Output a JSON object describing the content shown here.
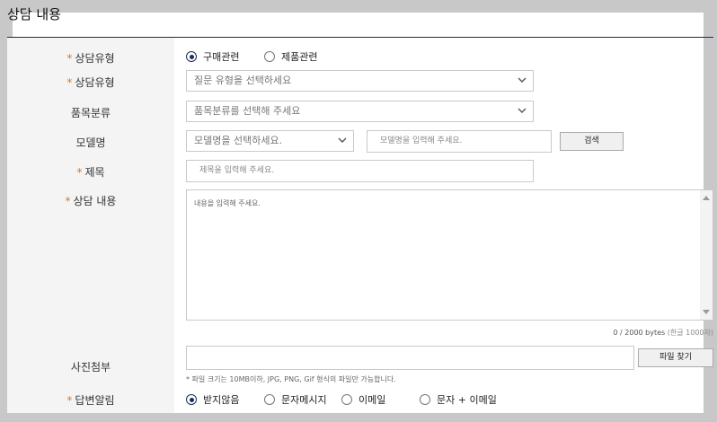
{
  "header": {
    "title": "상담 내용"
  },
  "form": {
    "inquiry_type": {
      "label": "상담유형",
      "required_mark": "*",
      "options": [
        "구매관련",
        "제품관련"
      ],
      "selected": 0
    },
    "inquiry_type_select": {
      "label": "상담유형",
      "required_mark": "*",
      "placeholder": "질문 유형을 선택하세요"
    },
    "category": {
      "label": "품목분류",
      "placeholder": "품목분류를 선택해 주세요"
    },
    "model": {
      "label": "모델명",
      "select_placeholder": "모델명을 선택하세요.",
      "input_placeholder": "모델명을 입력해 주세요.",
      "search_button": "검색"
    },
    "subject": {
      "label": "제목",
      "required_mark": "*",
      "placeholder": "제목을 입력해 주세요."
    },
    "content": {
      "label": "상담 내용",
      "required_mark": "*",
      "placeholder": "내용을 입력해 주세요.",
      "byte_count": "0 / 2000 bytes",
      "byte_hint": "(한글 1000자)"
    },
    "attachment": {
      "label": "사진첨부",
      "button": "파일 찾기",
      "note": "* 파일 크기는 10MB이하, JPG, PNG, Gif 형식의 파일만 가능합니다."
    },
    "reply_notify": {
      "label": "답변알림",
      "required_mark": "*",
      "options": [
        "받지않음",
        "문자메시지",
        "이메일",
        "문자 + 이메일"
      ],
      "selected": 0
    }
  },
  "colors": {
    "required": "#e0781c",
    "accent": "#1a2c5a",
    "title_rule": "#1d2f4a"
  }
}
